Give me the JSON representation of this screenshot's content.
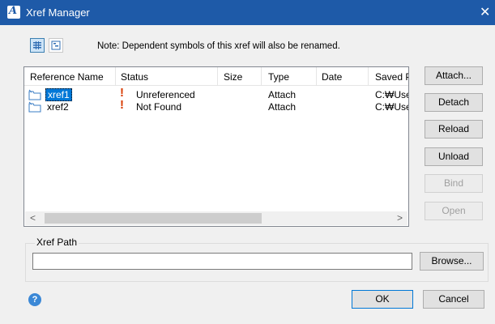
{
  "window": {
    "title": "Xref Manager",
    "close_glyph": "✕",
    "app_glyph": "A"
  },
  "toolbar": {
    "list_view_icon": "list-view-icon",
    "tree_view_icon": "tree-view-icon",
    "note": "Note: Dependent symbols of this xref will also be renamed."
  },
  "table": {
    "columns": [
      "Reference Name",
      "Status",
      "Size",
      "Type",
      "Date",
      "Saved P"
    ],
    "rows": [
      {
        "name": "xref1",
        "status": "Unreferenced",
        "size": "",
        "type": "Attach",
        "date": "",
        "saved_path": "C:₩Use"
      },
      {
        "name": "xref2",
        "status": "Not Found",
        "size": "",
        "type": "Attach",
        "date": "",
        "saved_path": "C:₩Use"
      }
    ],
    "warn_glyph": "!",
    "scroll_left": "<",
    "scroll_right": ">"
  },
  "buttons": {
    "attach": "Attach...",
    "detach": "Detach",
    "reload": "Reload",
    "unload": "Unload",
    "bind": "Bind",
    "open": "Open",
    "browse": "Browse...",
    "ok": "OK",
    "cancel": "Cancel"
  },
  "xref_path": {
    "label": "Xref Path",
    "value": ""
  },
  "help": {
    "glyph": "?"
  },
  "colors": {
    "title_bar": "#1e5aa8",
    "selection": "#0078d7",
    "warning": "#d83b01"
  }
}
